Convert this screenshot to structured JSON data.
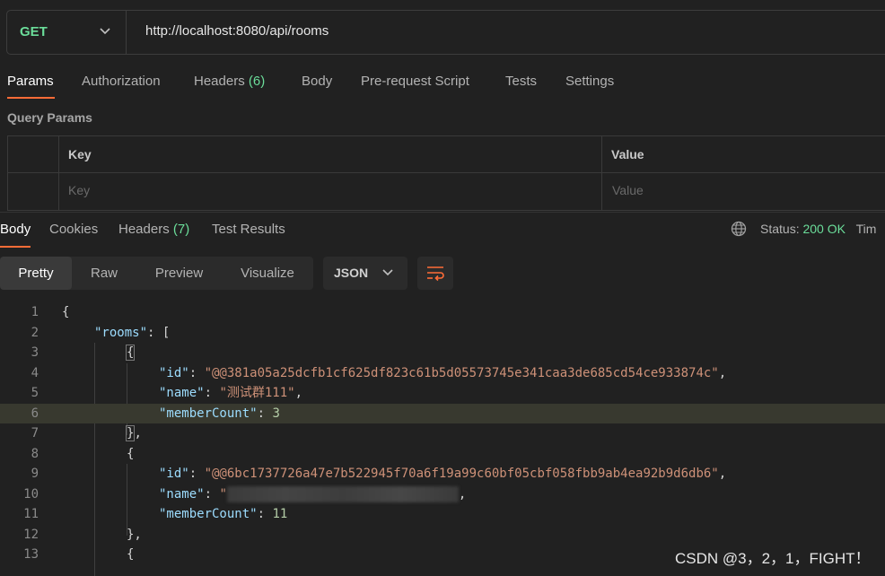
{
  "request": {
    "method": "GET",
    "url": "http://localhost:8080/api/rooms"
  },
  "request_tabs": [
    {
      "label": "Params",
      "count": ""
    },
    {
      "label": "Authorization",
      "count": ""
    },
    {
      "label": "Headers",
      "count": "(6)"
    },
    {
      "label": "Body",
      "count": ""
    },
    {
      "label": "Pre-request Script",
      "count": ""
    },
    {
      "label": "Tests",
      "count": ""
    },
    {
      "label": "Settings",
      "count": ""
    }
  ],
  "query_params": {
    "title": "Query Params",
    "key_header": "Key",
    "value_header": "Value",
    "key_placeholder": "Key",
    "value_placeholder": "Value"
  },
  "response_tabs": [
    {
      "label": "Body",
      "count": ""
    },
    {
      "label": "Cookies",
      "count": ""
    },
    {
      "label": "Headers",
      "count": "(7)"
    },
    {
      "label": "Test Results",
      "count": ""
    }
  ],
  "status": {
    "label": "Status:",
    "value": "200 OK",
    "time_label": "Tim"
  },
  "view_modes": [
    "Pretty",
    "Raw",
    "Preview",
    "Visualize"
  ],
  "format": "JSON",
  "code": {
    "line_numbers": [
      "1",
      "2",
      "3",
      "4",
      "5",
      "6",
      "7",
      "8",
      "9",
      "10",
      "11",
      "12",
      "13"
    ],
    "rooms_key": "\"rooms\"",
    "id_key": "\"id\"",
    "name_key": "\"name\"",
    "member_key": "\"memberCount\"",
    "room1_id": "\"@@381a05a25dcfb1cf625df823c61b5d05573745e341caa3de685cd54ce933874c\"",
    "room1_name": "\"测试群111\"",
    "room1_count": "3",
    "room2_id": "\"@@6bc1737726a47e7b522945f70a6f19a99c60bf05cbf058fbb9ab4ea92b9d6db6\"",
    "room2_name_open": "\"",
    "room2_count": "11"
  },
  "watermark": "CSDN @3，2，1，FIGHT！",
  "colors": {
    "accent": "#ff6c37",
    "method": "#6bdd9a",
    "status_ok": "#6bdd9a"
  }
}
